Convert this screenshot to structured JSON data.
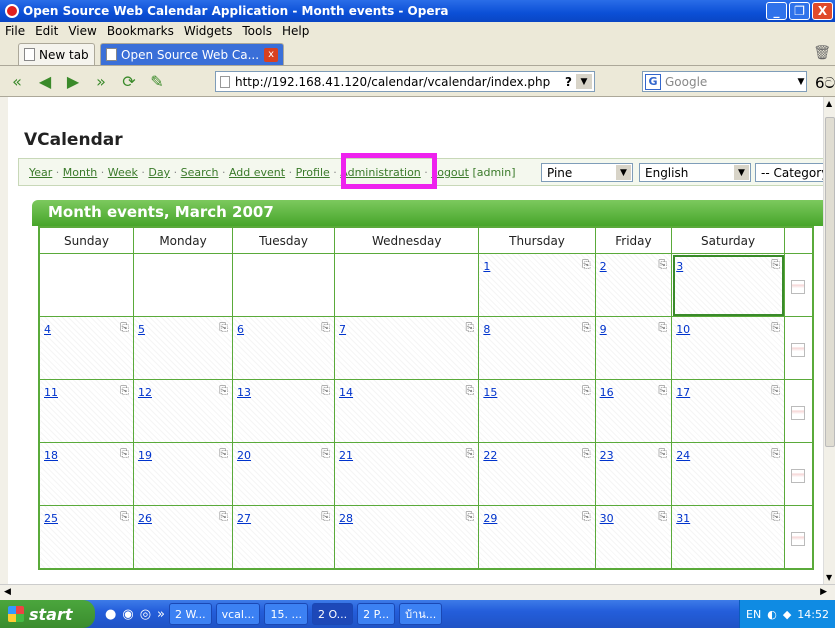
{
  "window": {
    "title": "Open Source Web Calendar Application - Month events - Opera",
    "minimize": "_",
    "maximize": "❐",
    "close": "X"
  },
  "menu": [
    "File",
    "Edit",
    "View",
    "Bookmarks",
    "Widgets",
    "Tools",
    "Help"
  ],
  "tabs": {
    "new_tab": "New tab",
    "active_tab": "Open Source Web Ca...",
    "close": "x"
  },
  "address": {
    "url": "http://192.168.41.120/calendar/vcalendar/index.php",
    "help": "?",
    "search_placeholder": "Google"
  },
  "app": {
    "title": "VCalendar",
    "nav": [
      "Year",
      "Month",
      "Week",
      "Day",
      "Search",
      "Add event",
      "Profile",
      "Administration",
      "Logout"
    ],
    "user": "[admin]",
    "style_select": "Pine",
    "language_select": "English",
    "category_select": "-- Category"
  },
  "calendar": {
    "heading": "Month events, March 2007",
    "weekdays": [
      "Sunday",
      "Monday",
      "Tuesday",
      "Wednesday",
      "Thursday",
      "Friday",
      "Saturday"
    ],
    "weeks": [
      [
        "",
        "",
        "",
        "",
        "1",
        "2",
        "3"
      ],
      [
        "4",
        "5",
        "6",
        "7",
        "8",
        "9",
        "10"
      ],
      [
        "11",
        "12",
        "13",
        "14",
        "15",
        "16",
        "17"
      ],
      [
        "18",
        "19",
        "20",
        "21",
        "22",
        "23",
        "24"
      ],
      [
        "25",
        "26",
        "27",
        "28",
        "29",
        "30",
        "31"
      ]
    ],
    "today": "3"
  },
  "taskbar": {
    "start": "start",
    "buttons": [
      "2 W...",
      "vcal...",
      "15. ...",
      "2 O...",
      "2 P...",
      "บ้าน..."
    ],
    "lang": "EN",
    "clock": "14:52"
  },
  "colors": {
    "accent_green": "#47a52a",
    "highlight_magenta": "#ee22ee",
    "link_blue": "#0033cc"
  }
}
